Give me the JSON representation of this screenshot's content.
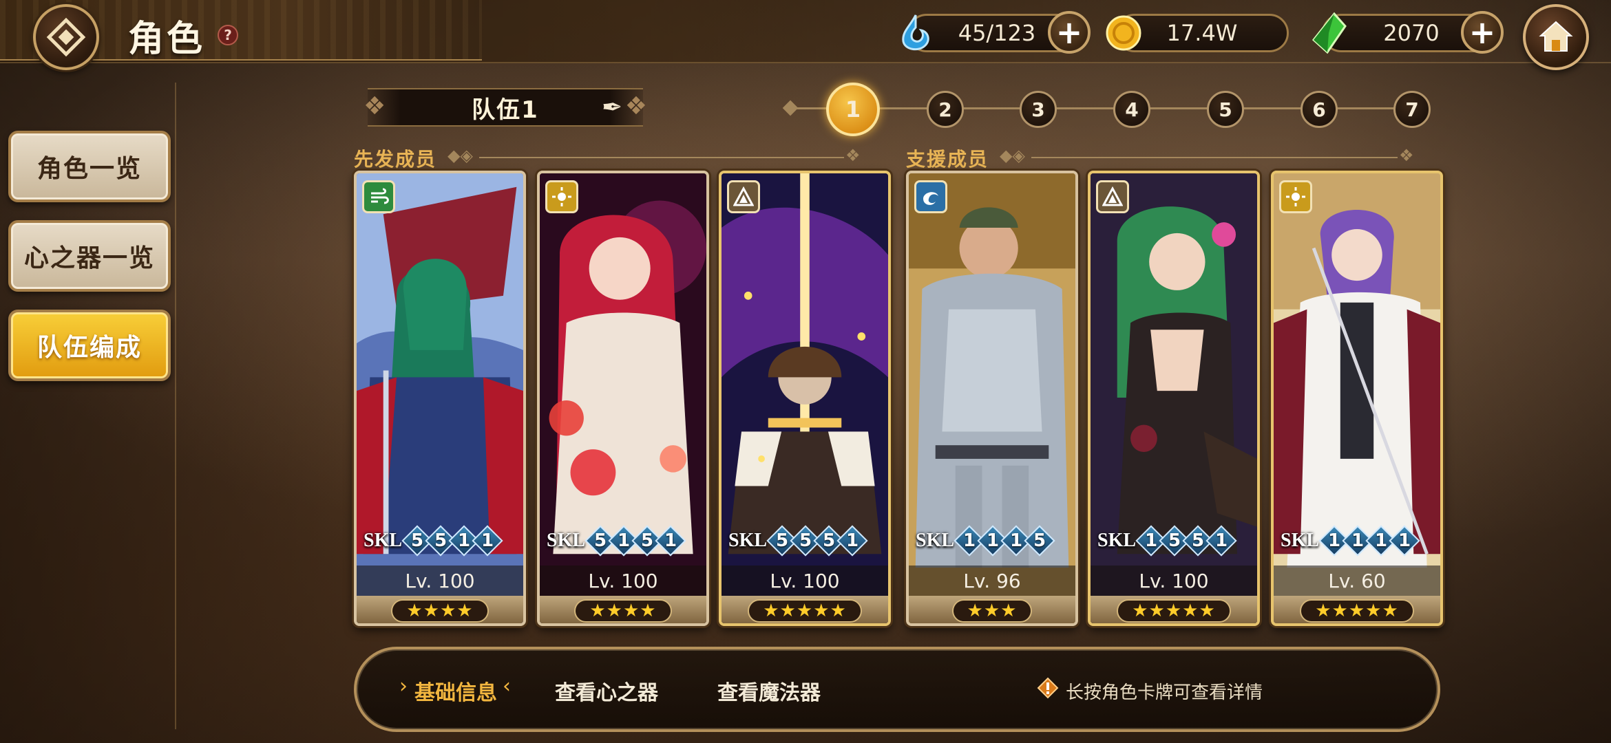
{
  "header": {
    "title": "角色",
    "help": "?",
    "resources": [
      {
        "name": "stamina",
        "icon": "water-drop-icon",
        "value": "45/123"
      },
      {
        "name": "gold",
        "icon": "gold-coin-icon",
        "value": "17.4W"
      },
      {
        "name": "gem",
        "icon": "green-crystal-icon",
        "value": "2070"
      }
    ]
  },
  "sidebar": {
    "items": [
      {
        "label": "角色一览",
        "active": false
      },
      {
        "label": "心之器一览",
        "active": false
      },
      {
        "label": "队伍编成",
        "active": true
      }
    ]
  },
  "team": {
    "name": "队伍1",
    "slots": [
      "1",
      "2",
      "3",
      "4",
      "5",
      "6",
      "7"
    ],
    "active_slot": "1"
  },
  "sections": {
    "starting": "先发成员",
    "support": "支援成员"
  },
  "cards": [
    {
      "element": "wind",
      "skl_tag": "SKL",
      "skills": [
        "5",
        "5",
        "1",
        "1"
      ],
      "level": "Lv. 100",
      "stars": "★★★★",
      "frame": "silver"
    },
    {
      "element": "light",
      "skl_tag": "SKL",
      "skills": [
        "5",
        "1",
        "5",
        "1"
      ],
      "level": "Lv. 100",
      "stars": "★★★★",
      "frame": "silver"
    },
    {
      "element": "earth",
      "skl_tag": "SKL",
      "skills": [
        "5",
        "5",
        "5",
        "1"
      ],
      "level": "Lv. 100",
      "stars": "★★★★★",
      "frame": "gold"
    },
    {
      "element": "water",
      "skl_tag": "SKL",
      "skills": [
        "1",
        "1",
        "1",
        "5"
      ],
      "level": "Lv. 96",
      "stars": "★★★",
      "frame": "silver"
    },
    {
      "element": "earth",
      "skl_tag": "SKL",
      "skills": [
        "1",
        "5",
        "5",
        "1"
      ],
      "level": "Lv. 100",
      "stars": "★★★★★",
      "frame": "gold"
    },
    {
      "element": "light",
      "skl_tag": "SKL",
      "skills": [
        "1",
        "1",
        "1",
        "1"
      ],
      "level": "Lv. 60",
      "stars": "★★★★★",
      "frame": "gold"
    }
  ],
  "bottom": {
    "tabs": [
      "基础信息",
      "查看心之器",
      "查看魔法器"
    ],
    "active_tab": "基础信息",
    "hint": "长按角色卡牌可查看详情"
  },
  "colors": {
    "accent_gold": "#f2b63f",
    "active_step": "#e39a1c",
    "frame_gold": "#e7c46d"
  }
}
